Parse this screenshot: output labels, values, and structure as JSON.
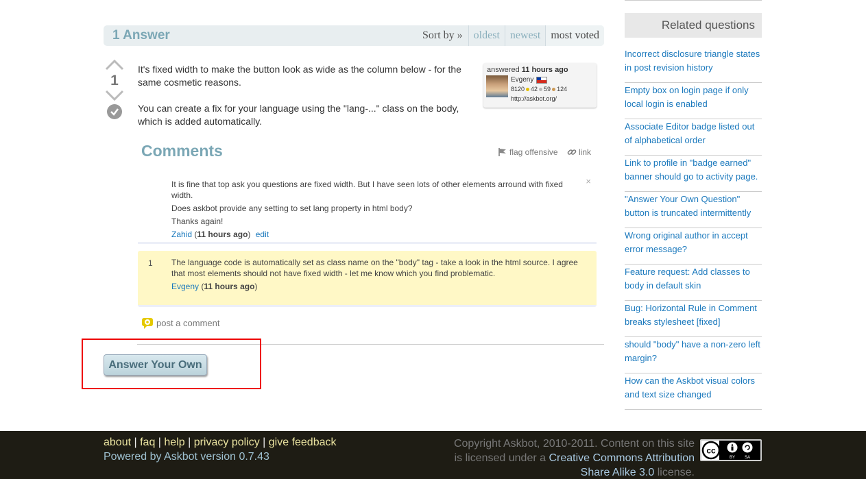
{
  "answers": {
    "count_label": "1 Answer",
    "sort_label": "Sort by »",
    "tabs": [
      "oldest",
      "newest",
      "most voted"
    ],
    "active_tab": "most voted"
  },
  "answer": {
    "votes": "1",
    "paragraphs": [
      "It's fixed width to make the button look as wide as the column below - for the same cosmetic reasons.",
      "You can create a fix for your language using the \"lang-...\" class on the body, which is added automatically."
    ],
    "answered_prefix": "answered",
    "answered_time": "11 hours ago",
    "user": {
      "name": "Evgeny",
      "reputation": "8120",
      "gold": "42",
      "silver": "59",
      "bronze": "124",
      "website": "http://askbot.org/"
    }
  },
  "comments": {
    "title": "Comments",
    "flag_label": "flag offensive",
    "link_label": "link",
    "items": [
      {
        "score": "",
        "lines": [
          "It is fine that top ask you questions are fixed width. But I have seen lots of other elements arround with fixed width.",
          "Does askbot provide any setting to set lang property in html body?",
          "Thanks again!"
        ],
        "author": "Zahid",
        "time": "11 hours ago",
        "edit": "edit",
        "delete": "×"
      },
      {
        "score": "1",
        "lines": [
          "The language code is automatically set as class name on the \"body\" tag - take a look in the html source. I agree that most elements should not have fixed width - let me know which you find problematic."
        ],
        "author": "Evgeny",
        "time": "11 hours ago"
      }
    ],
    "post_comment": "post a comment"
  },
  "answer_own_button": "Answer Your Own",
  "sidebar": {
    "title": "Related questions",
    "items": [
      "Incorrect disclosure triangle states in post revision history",
      "Empty box on login page if only local login is enabled",
      "Associate Editor badge listed out of alphabetical order",
      "Link to profile in \"badge earned\" banner should go to activity page.",
      "\"Answer Your Own Question\" button is truncated intermittently",
      "Wrong original author in accept error message?",
      "Feature request: Add classes to body in default skin",
      "Bug: Horizontal Rule in Comment breaks stylesheet [fixed]",
      "should \"body\" have a non-zero left margin?",
      "How can the Askbot visual colors and text size changed"
    ]
  },
  "footer": {
    "links": [
      "about",
      "faq",
      "help",
      "privacy policy",
      "give feedback"
    ],
    "powered": "Powered by Askbot version 0.7.43",
    "copyright_text": "Copyright Askbot, 2010-2011. Content on this site is licensed under a",
    "license_link": "Creative Commons Attribution Share Alike 3.0",
    "license_suffix": "license.",
    "cc_labels": [
      "BY",
      "SA"
    ]
  }
}
